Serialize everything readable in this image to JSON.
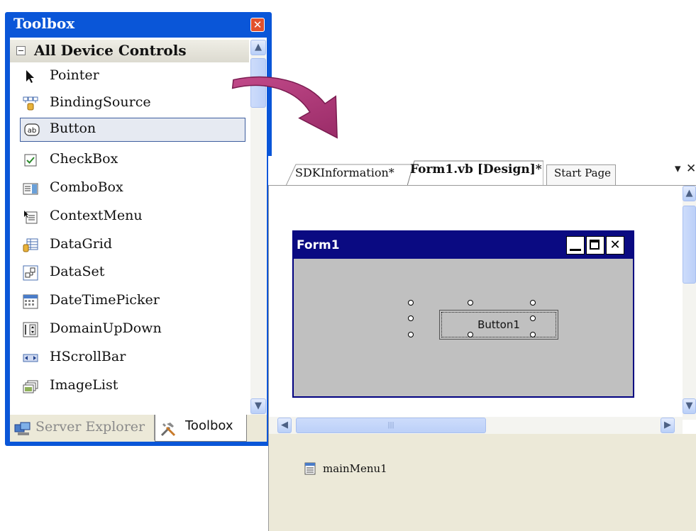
{
  "toolbox": {
    "title": "Toolbox",
    "group_label": "All Device Controls",
    "items": [
      {
        "label": "Pointer",
        "icon": "pointer-icon"
      },
      {
        "label": "BindingSource",
        "icon": "binding-source-icon"
      },
      {
        "label": "Button",
        "icon": "button-icon",
        "selected": true
      },
      {
        "label": "CheckBox",
        "icon": "checkbox-icon"
      },
      {
        "label": "ComboBox",
        "icon": "combobox-icon"
      },
      {
        "label": "ContextMenu",
        "icon": "context-menu-icon"
      },
      {
        "label": "DataGrid",
        "icon": "datagrid-icon"
      },
      {
        "label": "DataSet",
        "icon": "dataset-icon"
      },
      {
        "label": "DateTimePicker",
        "icon": "datetimepicker-icon"
      },
      {
        "label": "DomainUpDown",
        "icon": "domain-updown-icon"
      },
      {
        "label": "HScrollBar",
        "icon": "hscrollbar-icon"
      },
      {
        "label": "ImageList",
        "icon": "imagelist-icon"
      }
    ],
    "tabs": [
      {
        "label": "Server Explorer",
        "icon": "server-explorer-icon"
      },
      {
        "label": "Toolbox",
        "icon": "toolbox-tools-icon"
      }
    ]
  },
  "designer": {
    "tabs": [
      {
        "label": "SDKInformation*"
      },
      {
        "label": "Form1.vb [Design]*"
      },
      {
        "label": "Start Page"
      }
    ],
    "form": {
      "title": "Form1",
      "button_label": "Button1"
    },
    "tray": {
      "component_label": "mainMenu1"
    }
  },
  "colors": {
    "xp_blue": "#0a56d8",
    "form_titlebar": "#0a0a82",
    "form_background": "#c0c0c0",
    "arrow": "#b03a78",
    "tray_background": "#ece9d8"
  }
}
